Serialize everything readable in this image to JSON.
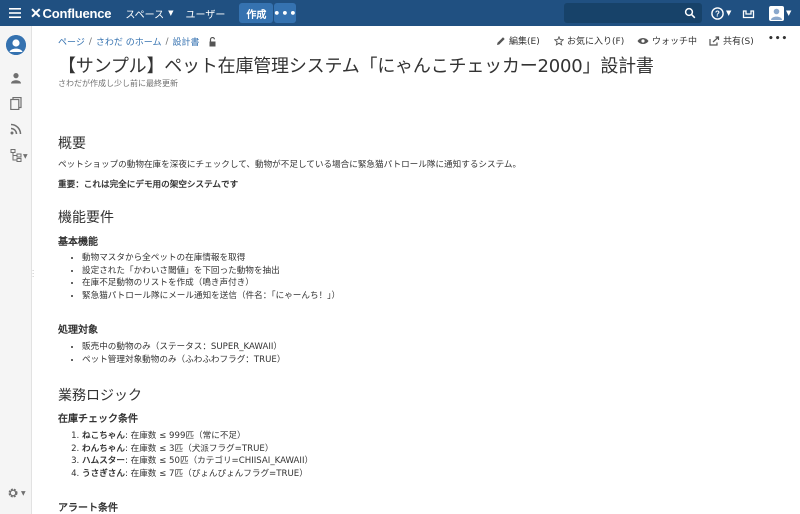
{
  "header": {
    "logo_text": "Confluence",
    "nav": [
      {
        "label": "スペース",
        "has_caret": true
      },
      {
        "label": "ユーザー",
        "has_caret": false
      }
    ],
    "create_label": "作成",
    "more_label": "•••",
    "search_placeholder": ""
  },
  "breadcrumb": [
    "ページ",
    "さわだ のホーム",
    "設計書"
  ],
  "actions": {
    "edit": "編集(E)",
    "favorite": "お気に入り(F)",
    "watch": "ウォッチ中",
    "share": "共有(S)",
    "more": "•••"
  },
  "page": {
    "title": "【サンプル】ペット在庫管理システム「にゃんこチェッカー2000」設計書",
    "byline": "さわだが作成し少し前に最終更新"
  },
  "sections": {
    "overview": {
      "heading": "概要",
      "text": "ペットショップの動物在庫を深夜にチェックして、動物が不足している場合に緊急猫パトロール隊に通知するシステム。",
      "note": "重要：これは完全にデモ用の架空システムです"
    },
    "requirements": {
      "heading": "機能要件",
      "basic_heading": "基本機能",
      "basic_items": [
        "動物マスタから全ペットの在庫情報を取得",
        "設定された「かわいさ閾値」を下回った動物を抽出",
        "在庫不足動物のリストを作成（鳴き声付き）",
        "緊急猫パトロール隊にメール通知を送信（件名：「にゃーんち！」）"
      ],
      "target_heading": "処理対象",
      "target_items": [
        "販売中の動物のみ（ステータス：SUPER_KAWAII）",
        "ペット管理対象動物のみ（ふわふわフラグ：TRUE）"
      ]
    },
    "logic": {
      "heading": "業務ロジック",
      "check_heading": "在庫チェック条件",
      "check_items": [
        {
          "name": "ねこちゃん",
          "cond": ": 在庫数 ≤ 999匹（常に不足）"
        },
        {
          "name": "わんちゃん",
          "cond": ": 在庫数 ≤ 3匹（犬派フラグ=TRUE）"
        },
        {
          "name": "ハムスター",
          "cond": ": 在庫数 ≤ 50匹（カテゴリ=CHIISAI_KAWAII）"
        },
        {
          "name": "うさぎさん",
          "cond": ": 在庫数 ≤ 7匹（ぴょんぴょんフラグ=TRUE）"
        }
      ],
      "alert_heading": "アラート条件"
    }
  }
}
